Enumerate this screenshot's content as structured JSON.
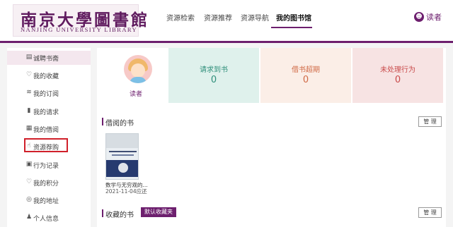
{
  "header": {
    "logo_cn": "南京大學圖書館",
    "logo_en": "NANJING UNIVERSITY LIBRARY",
    "nav": [
      "资源检索",
      "资源推荐",
      "资源导航",
      "我的图书馆"
    ],
    "user_label": "读者",
    "user_icon": "person-icon"
  },
  "sidebar": {
    "items": [
      {
        "label": "诚聘书斋",
        "icon": "book-icon"
      },
      {
        "label": "我的收藏",
        "icon": "heart-icon"
      },
      {
        "label": "我的订阅",
        "icon": "rss-icon"
      },
      {
        "label": "我的请求",
        "icon": "request-icon"
      },
      {
        "label": "我的借阅",
        "icon": "borrow-icon"
      },
      {
        "label": "资源荐购",
        "icon": "thumb-up-icon"
      },
      {
        "label": "行为记录",
        "icon": "record-icon"
      },
      {
        "label": "我的积分",
        "icon": "points-icon"
      },
      {
        "label": "我的地址",
        "icon": "location-icon"
      },
      {
        "label": "个人信息",
        "icon": "user-icon"
      }
    ]
  },
  "profile": {
    "name": "读者"
  },
  "stats": [
    {
      "label": "请求到书",
      "value": "0"
    },
    {
      "label": "借书超期",
      "value": "0"
    },
    {
      "label": "未处理行为",
      "value": "0"
    }
  ],
  "borrowed": {
    "title": "借阅的书",
    "manage": "管 理",
    "book_title": "数学与无穷观的...",
    "book_date": "2021-11-04应还"
  },
  "favorites": {
    "title": "收藏的书",
    "tag": "默认收藏夹",
    "manage": "管 理"
  },
  "colors": {
    "brand": "#6d1f6e",
    "highlight": "#d0202a"
  }
}
